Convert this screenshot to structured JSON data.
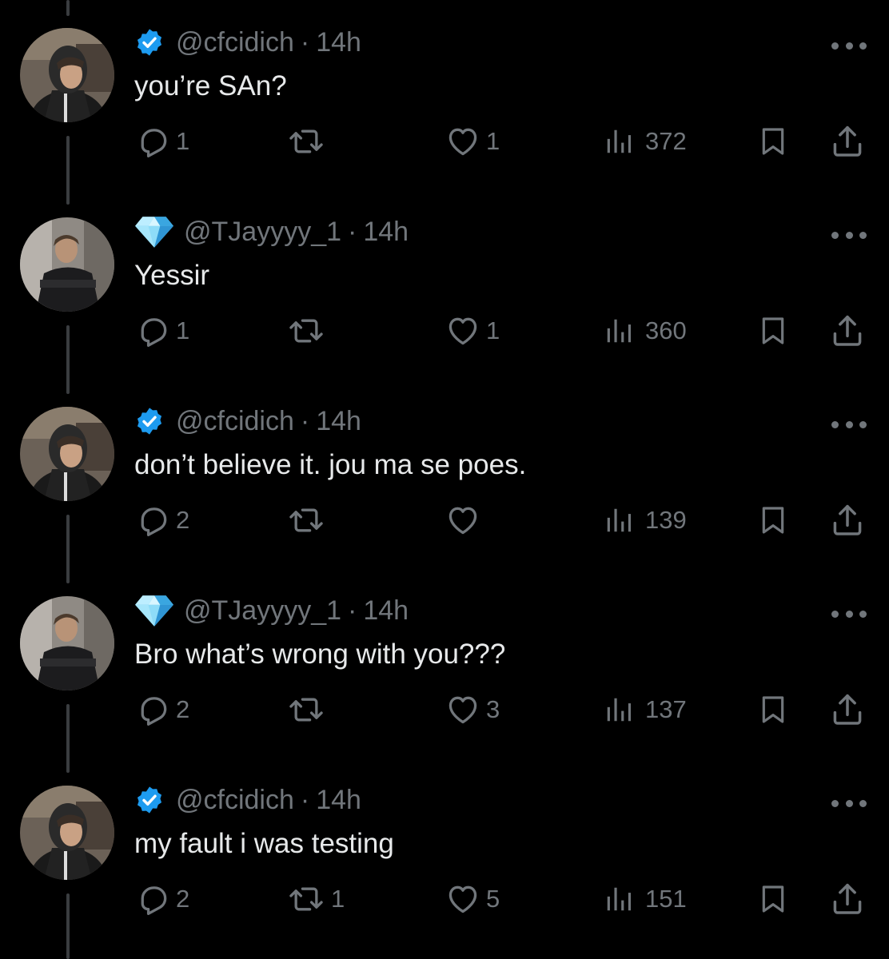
{
  "colors": {
    "background": "#000000",
    "text_primary": "#e7e9ea",
    "text_secondary": "#71767b",
    "verified_blue": "#1d9bf0",
    "diamond": "#7fd6f5"
  },
  "icons": {
    "reply": "speech-bubble-icon",
    "retweet": "retweet-arrows-icon",
    "like": "heart-icon",
    "views": "bar-chart-icon",
    "bookmark": "bookmark-icon",
    "share": "share-upload-icon",
    "more": "ellipsis-icon",
    "verified": "verified-badge-icon",
    "diamond": "diamond-icon"
  },
  "tweets": [
    {
      "handle": "@cfcidich",
      "separator": "·",
      "time": "14h",
      "badge": "verified",
      "text": "you’re SAn?",
      "replies": "1",
      "retweets": "",
      "likes": "1",
      "views": "372"
    },
    {
      "handle": "@TJayyyy_1",
      "separator": "·",
      "time": "14h",
      "badge": "diamond",
      "text": "Yessir",
      "replies": "1",
      "retweets": "",
      "likes": "1",
      "views": "360"
    },
    {
      "handle": "@cfcidich",
      "separator": "·",
      "time": "14h",
      "badge": "verified",
      "text": "don’t believe it. jou ma se poes.",
      "replies": "2",
      "retweets": "",
      "likes": "",
      "views": "139"
    },
    {
      "handle": "@TJayyyy_1",
      "separator": "·",
      "time": "14h",
      "badge": "diamond",
      "text": "Bro what’s wrong with you???",
      "replies": "2",
      "retweets": "",
      "likes": "3",
      "views": "137"
    },
    {
      "handle": "@cfcidich",
      "separator": "·",
      "time": "14h",
      "badge": "verified",
      "text": "my fault i was testing",
      "replies": "2",
      "retweets": "1",
      "likes": "5",
      "views": "151"
    }
  ]
}
